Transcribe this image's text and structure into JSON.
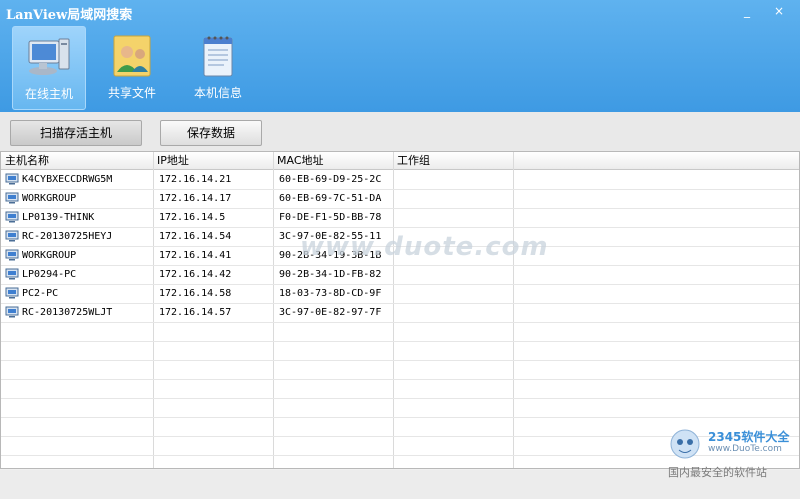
{
  "window": {
    "title": "LanView局域网搜索",
    "minimize": "_",
    "close": "×"
  },
  "toolbar": [
    {
      "label": "在线主机",
      "icon": "computer-icon",
      "active": true
    },
    {
      "label": "共享文件",
      "icon": "users-share-icon",
      "active": false
    },
    {
      "label": "本机信息",
      "icon": "notepad-icon",
      "active": false
    }
  ],
  "commands": {
    "scan": "扫描存活主机",
    "save": "保存数据"
  },
  "table": {
    "columns": [
      "主机名称",
      "IP地址",
      "MAC地址",
      "工作组"
    ],
    "rows": [
      [
        "K4CYBXECCDRWG5M",
        "172.16.14.21",
        "60-EB-69-D9-25-2C",
        ""
      ],
      [
        "WORKGROUP",
        "172.16.14.17",
        "60-EB-69-7C-51-DA",
        ""
      ],
      [
        "LP0139-THINK",
        "172.16.14.5",
        "F0-DE-F1-5D-BB-78",
        ""
      ],
      [
        "RC-20130725HEYJ",
        "172.16.14.54",
        "3C-97-0E-82-55-11",
        ""
      ],
      [
        "WORKGROUP",
        "172.16.14.41",
        "90-2B-34-19-3B-1B",
        ""
      ],
      [
        "LP0294-PC",
        "172.16.14.42",
        "90-2B-34-1D-FB-82",
        ""
      ],
      [
        "PC2-PC",
        "172.16.14.58",
        "18-03-73-8D-CD-9F",
        ""
      ],
      [
        "RC-20130725WLJT",
        "172.16.14.57",
        "3C-97-0E-82-97-7F",
        ""
      ]
    ]
  },
  "watermark": {
    "center": "www.duote.com",
    "brand": "2345软件大全",
    "url": "www.DuoTe.com",
    "slogan": "国内最安全的软件站"
  }
}
